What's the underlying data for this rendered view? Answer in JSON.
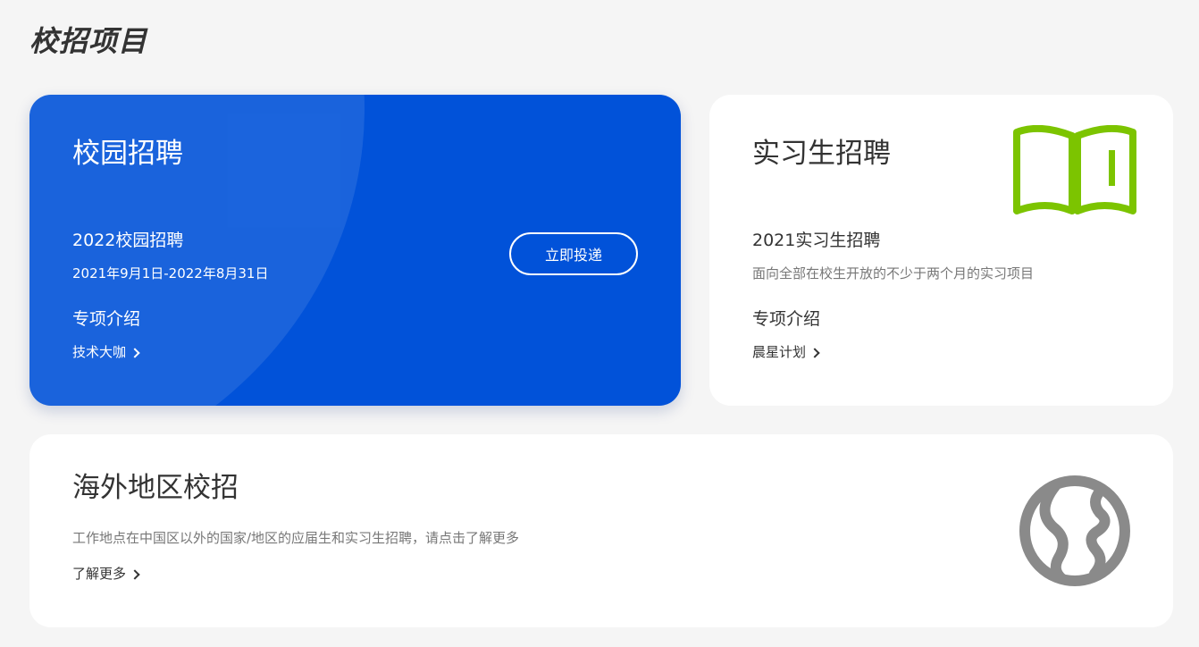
{
  "page": {
    "title": "校招项目"
  },
  "campus": {
    "title": "校园招聘",
    "program": "2022校园招聘",
    "dates": "2021年9月1日-2022年8月31日",
    "special_heading": "专项介绍",
    "special_link": "技术大咖",
    "apply_button": "立即投递",
    "color": "#0152d9"
  },
  "intern": {
    "title": "实习生招聘",
    "program": "2021实习生招聘",
    "description": "面向全部在校生开放的不少于两个月的实习项目",
    "special_heading": "专项介绍",
    "special_link": "晨星计划",
    "icon": "open-book-icon",
    "icon_color": "#7cc400"
  },
  "overseas": {
    "title": "海外地区校招",
    "description": "工作地点在中国区以外的国家/地区的应届生和实习生招聘，请点击了解更多",
    "more_link": "了解更多",
    "icon": "globe-icon",
    "icon_color": "#8a8a8a"
  }
}
